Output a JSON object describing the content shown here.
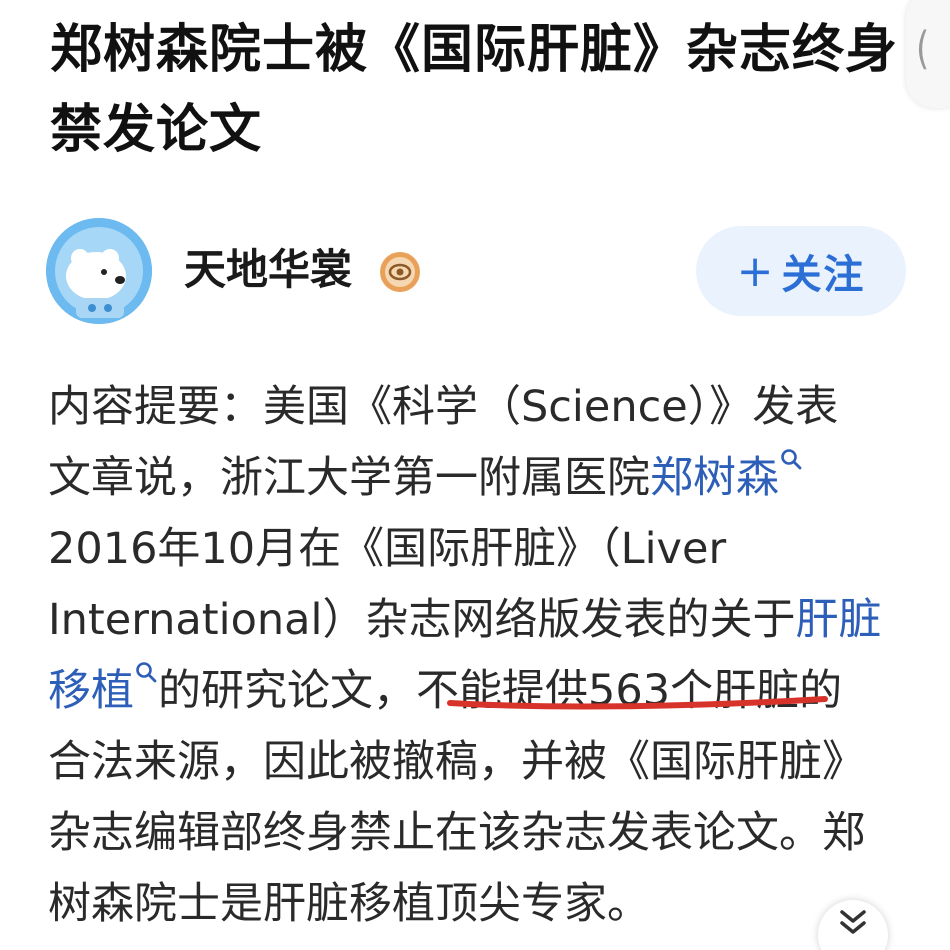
{
  "article": {
    "title": "郑树森院士被《国际肝脏》杂志终身禁发论文"
  },
  "author": {
    "name": "天地华裳",
    "avatar": "polar-bear-astronaut-avatar",
    "badge": "verified-badge-icon",
    "follow_plus": "+",
    "follow_label": "关注"
  },
  "content": {
    "line1": "内容提要：美国《科学（Science）》发表",
    "line2_text": "文章说，浙江大学第一附属医院",
    "line2_link": "郑树森",
    "line3": "2016年10月在《国际肝脏》（Liver",
    "line4_text": "International）杂志网络版发表的关于",
    "line4_link": "肝脏",
    "line5_link": "移植",
    "line5_text": "的研究论文，",
    "line5_highlight": "不能提供563个肝脏",
    "line5_tail": "的",
    "line6": "合法来源，因此被撤稿，并被《国际肝脏》",
    "line7": "杂志编辑部终身禁止在该杂志发表论文。郑",
    "line8": "树森院士是肝脏移植顶尖专家。"
  },
  "colors": {
    "link": "#2e5fb8",
    "follow_bg": "#eaf2fd",
    "follow_text": "#2b6fd6",
    "underline": "#d8332a"
  },
  "icons": {
    "edge_tab": "collapse-bracket-icon",
    "scroll": "chevron-double-down-icon"
  }
}
